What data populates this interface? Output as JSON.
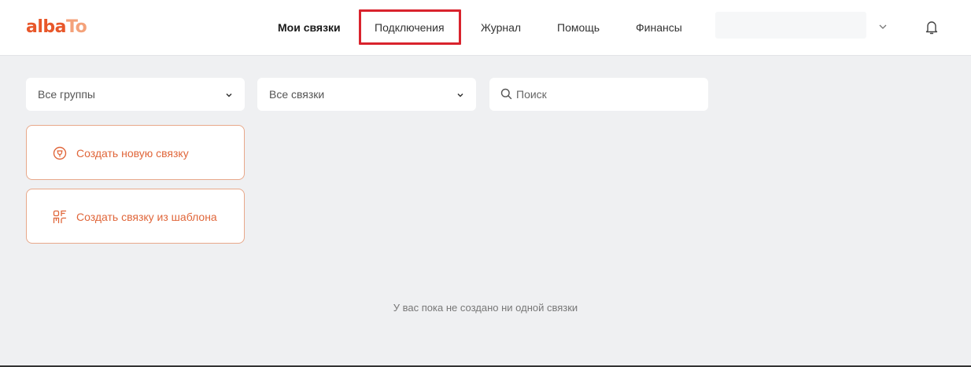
{
  "header": {
    "logo": {
      "part1": "alba",
      "part2": "To",
      "color_main": "#e8572a",
      "color_accent": "#f4a27a"
    },
    "nav": [
      {
        "label": "Мои связки",
        "active": true
      },
      {
        "label": "Подключения",
        "active": false,
        "highlighted": true
      },
      {
        "label": "Журнал",
        "active": false
      },
      {
        "label": "Помощь",
        "active": false
      },
      {
        "label": "Финансы",
        "active": false
      }
    ],
    "account_icon": "chevron-down-icon",
    "notifications_icon": "bell-icon"
  },
  "filters": {
    "groups_select": {
      "value": "Все группы"
    },
    "bundles_select": {
      "value": "Все связки"
    },
    "search": {
      "placeholder": "Поиск",
      "value": ""
    }
  },
  "actions": [
    {
      "label": "Создать новую связку",
      "icon": "plug-icon"
    },
    {
      "label": "Создать связку из шаблона",
      "icon": "template-icon"
    }
  ],
  "empty_state": {
    "message": "У вас пока не создано ни одной связки"
  },
  "colors": {
    "accent": "#e0663a",
    "highlight": "#d9232d",
    "background": "#eff0f2"
  }
}
